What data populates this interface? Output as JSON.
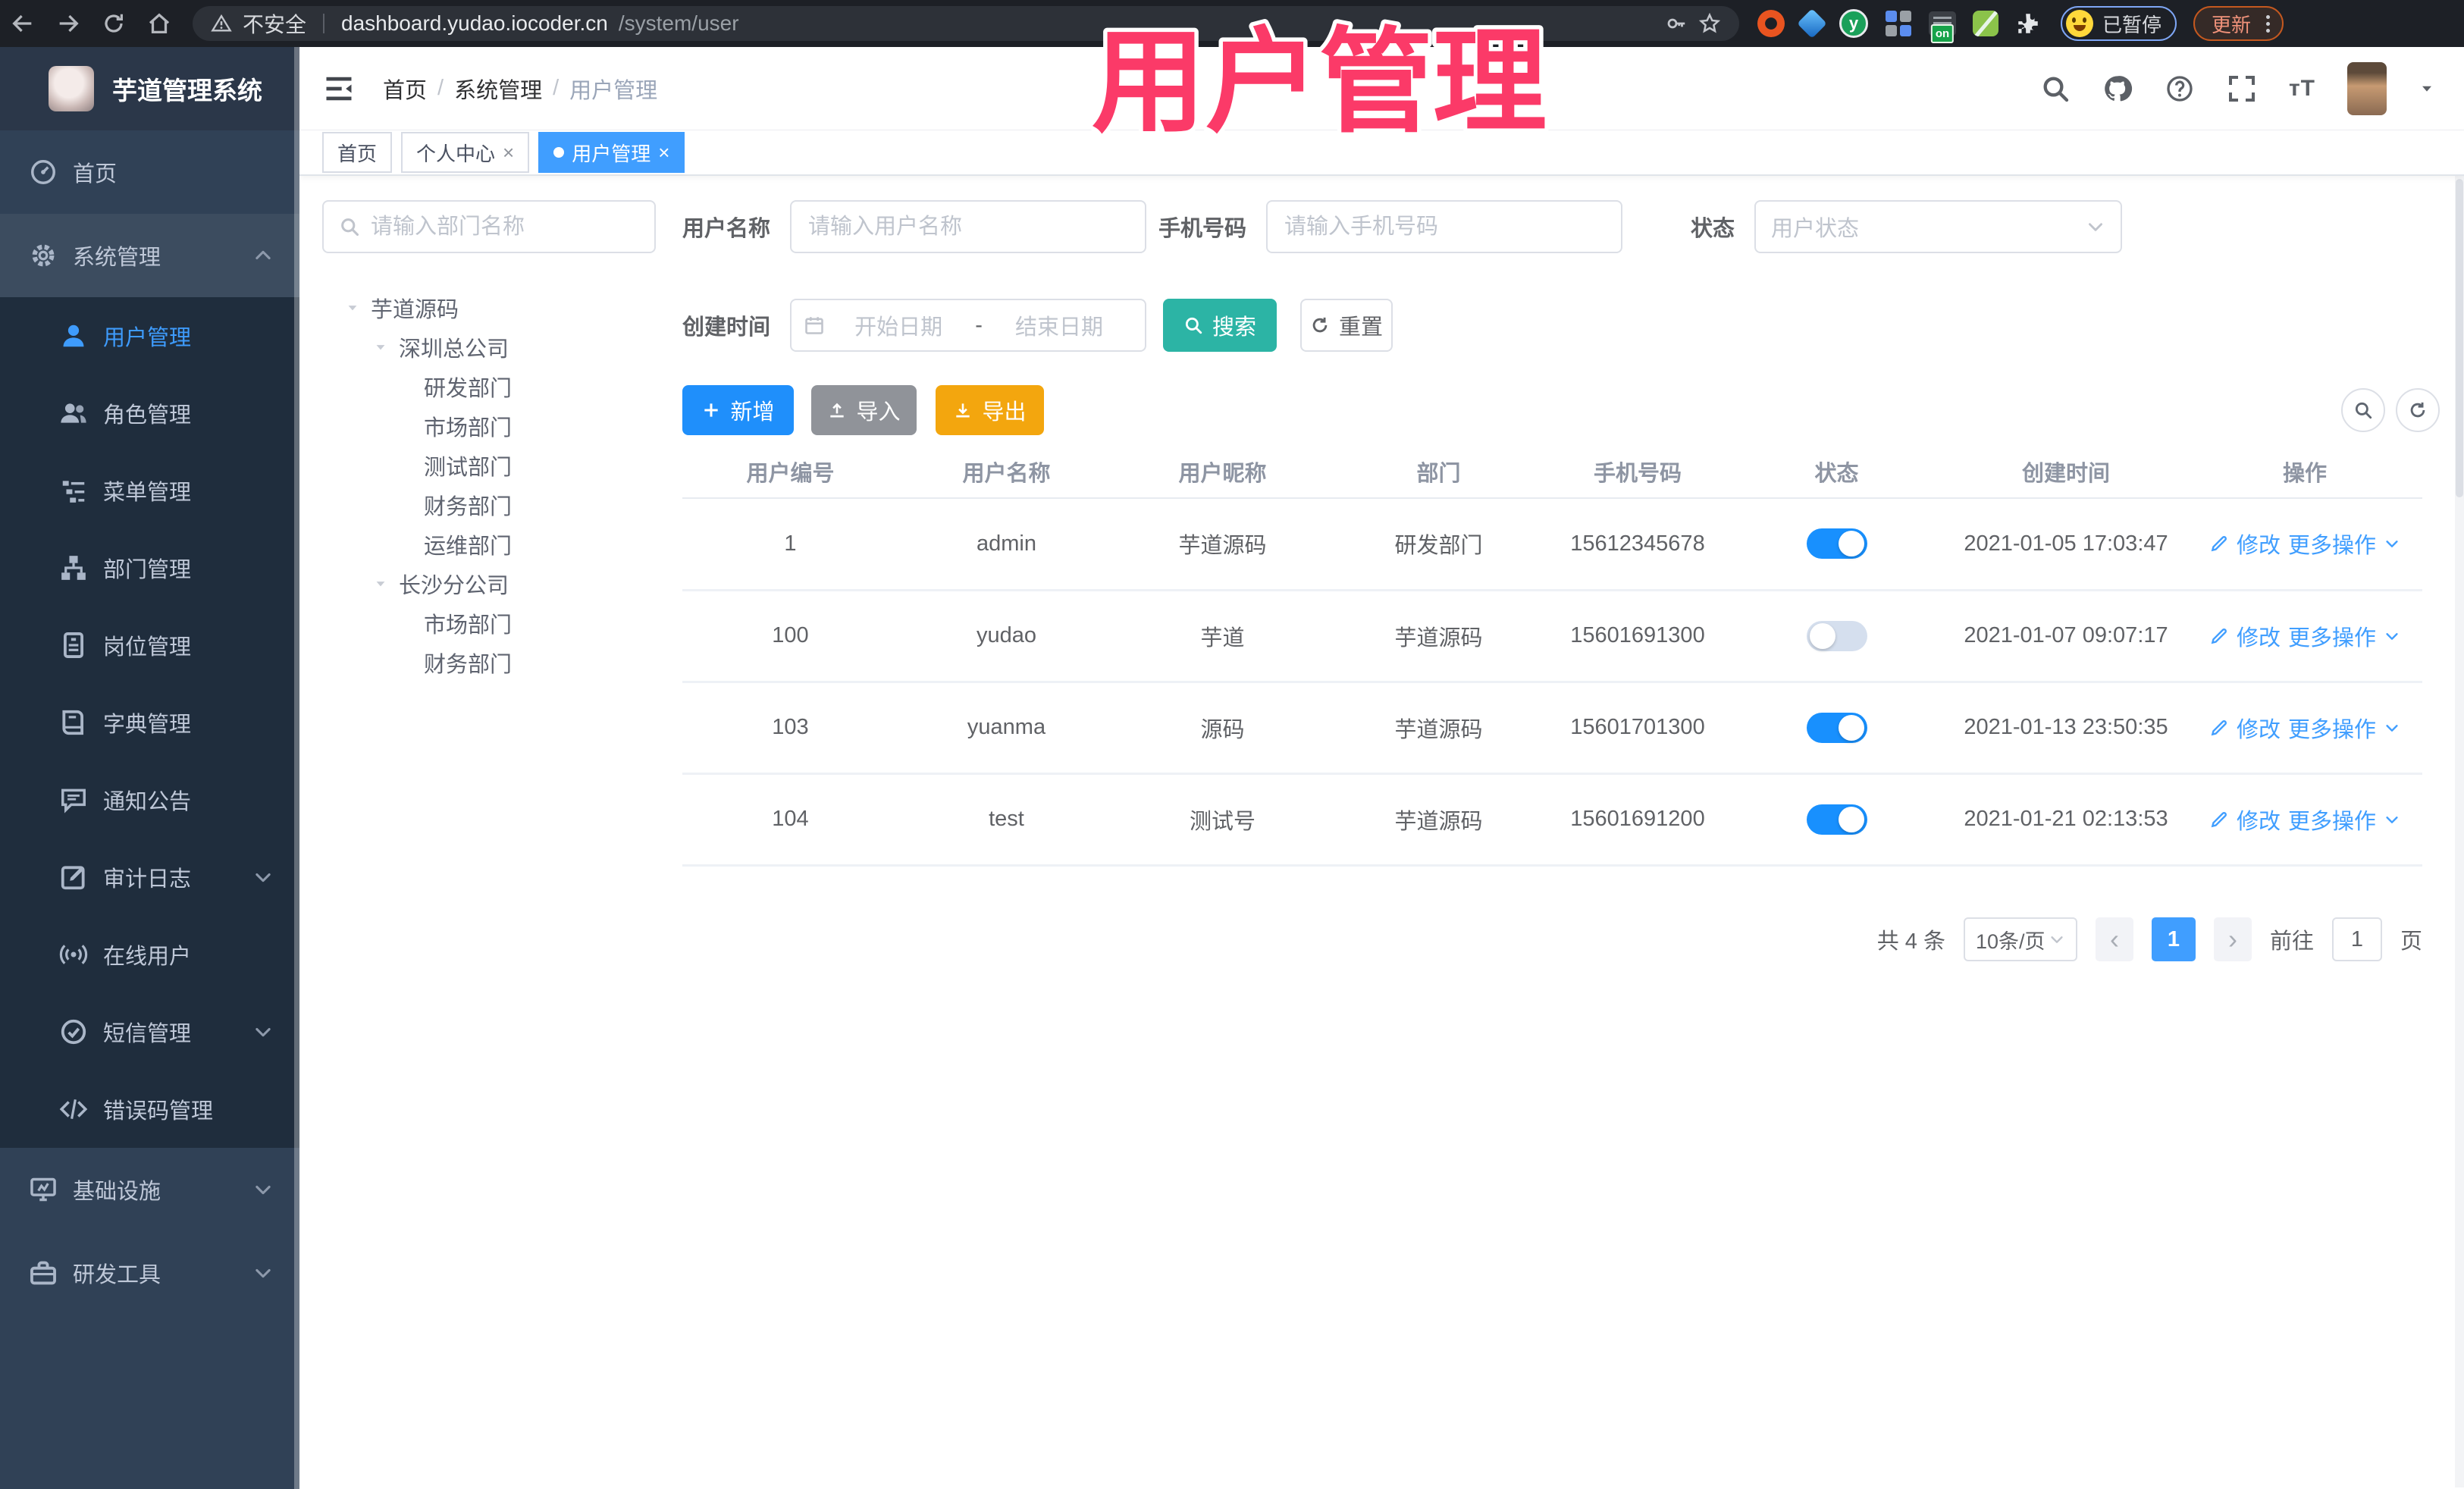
{
  "colors": {
    "primary": "#409eff",
    "sidebar_bg": "#304156",
    "submenu_bg": "#1f2d3d",
    "search_teal": "#2cb4a5",
    "export_orange": "#f3a60e",
    "import_gray": "#909399",
    "add_blue": "#1f8ffb",
    "toggle_on": "#1890fe",
    "overlay_pink": "#fb3a68",
    "active_tab": "#409eff",
    "browser_bar": "#1d2026"
  },
  "overlay": {
    "title": "用户管理"
  },
  "browser": {
    "security_label": "不安全",
    "url_host": "dashboard.yudao.iocoder.cn",
    "url_path": "/system/user",
    "extension_badge": "on",
    "profile_status": "已暂停",
    "update_label": "更新"
  },
  "header": {
    "logo_title": "芋道管理系统",
    "breadcrumb": [
      "首页",
      "系统管理",
      "用户管理"
    ]
  },
  "tabs": [
    {
      "label": "首页"
    },
    {
      "label": "个人中心"
    },
    {
      "label": "用户管理"
    }
  ],
  "sidebar": {
    "items": [
      {
        "label": "首页",
        "icon": "dashboard-icon"
      },
      {
        "label": "系统管理",
        "icon": "gear-icon",
        "expanded": true
      },
      {
        "label": "用户管理",
        "icon": "user-icon",
        "active": true
      },
      {
        "label": "角色管理",
        "icon": "users-icon"
      },
      {
        "label": "菜单管理",
        "icon": "menu-list-icon"
      },
      {
        "label": "部门管理",
        "icon": "org-tree-icon"
      },
      {
        "label": "岗位管理",
        "icon": "badge-icon"
      },
      {
        "label": "字典管理",
        "icon": "book-icon"
      },
      {
        "label": "通知公告",
        "icon": "speech-bubble-icon"
      },
      {
        "label": "审计日志",
        "icon": "edit-square-icon",
        "collapsed": true
      },
      {
        "label": "在线用户",
        "icon": "broadcast-icon"
      },
      {
        "label": "短信管理",
        "icon": "check-circle-icon",
        "collapsed": true
      },
      {
        "label": "错误码管理",
        "icon": "code-icon"
      },
      {
        "label": "基础设施",
        "icon": "monitor-icon",
        "collapsed": true
      },
      {
        "label": "研发工具",
        "icon": "toolbox-icon",
        "collapsed": true
      }
    ]
  },
  "dept": {
    "search_placeholder": "请输入部门名称",
    "tree": [
      {
        "label": "芋道源码",
        "level": 0,
        "expanded": true
      },
      {
        "label": "深圳总公司",
        "level": 1,
        "expanded": true
      },
      {
        "label": "研发部门",
        "level": 2
      },
      {
        "label": "市场部门",
        "level": 2
      },
      {
        "label": "测试部门",
        "level": 2
      },
      {
        "label": "财务部门",
        "level": 2
      },
      {
        "label": "运维部门",
        "level": 2
      },
      {
        "label": "长沙分公司",
        "level": 1,
        "expanded": true
      },
      {
        "label": "市场部门",
        "level": 2
      },
      {
        "label": "财务部门",
        "level": 2
      }
    ]
  },
  "form": {
    "username_label": "用户名称",
    "username_placeholder": "请输入用户名称",
    "mobile_label": "手机号码",
    "mobile_placeholder": "请输入手机号码",
    "status_label": "状态",
    "status_placeholder": "用户状态",
    "date_label": "创建时间",
    "date_start_placeholder": "开始日期",
    "date_separator": "-",
    "date_end_placeholder": "结束日期",
    "search_label": "搜索",
    "reset_label": "重置"
  },
  "toolbar": {
    "add_label": "新增",
    "import_label": "导入",
    "export_label": "导出"
  },
  "table": {
    "columns": [
      "用户编号",
      "用户名称",
      "用户昵称",
      "部门",
      "手机号码",
      "状态",
      "创建时间",
      "操作"
    ],
    "edit_label": "修改",
    "more_label": "更多操作",
    "rows": [
      {
        "id": "1",
        "username": "admin",
        "nickname": "芋道源码",
        "dept": "研发部门",
        "mobile": "15612345678",
        "status_on": true,
        "created": "2021-01-05 17:03:47"
      },
      {
        "id": "100",
        "username": "yudao",
        "nickname": "芋道",
        "dept": "芋道源码",
        "mobile": "15601691300",
        "status_on": false,
        "created": "2021-01-07 09:07:17"
      },
      {
        "id": "103",
        "username": "yuanma",
        "nickname": "源码",
        "dept": "芋道源码",
        "mobile": "15601701300",
        "status_on": true,
        "created": "2021-01-13 23:50:35"
      },
      {
        "id": "104",
        "username": "test",
        "nickname": "测试号",
        "dept": "芋道源码",
        "mobile": "15601691200",
        "status_on": true,
        "created": "2021-01-21 02:13:53"
      }
    ]
  },
  "pagination": {
    "total_text": "共 4 条",
    "page_size": "10条/页",
    "current_page": "1",
    "goto_label": "前往",
    "page_unit": "页"
  }
}
